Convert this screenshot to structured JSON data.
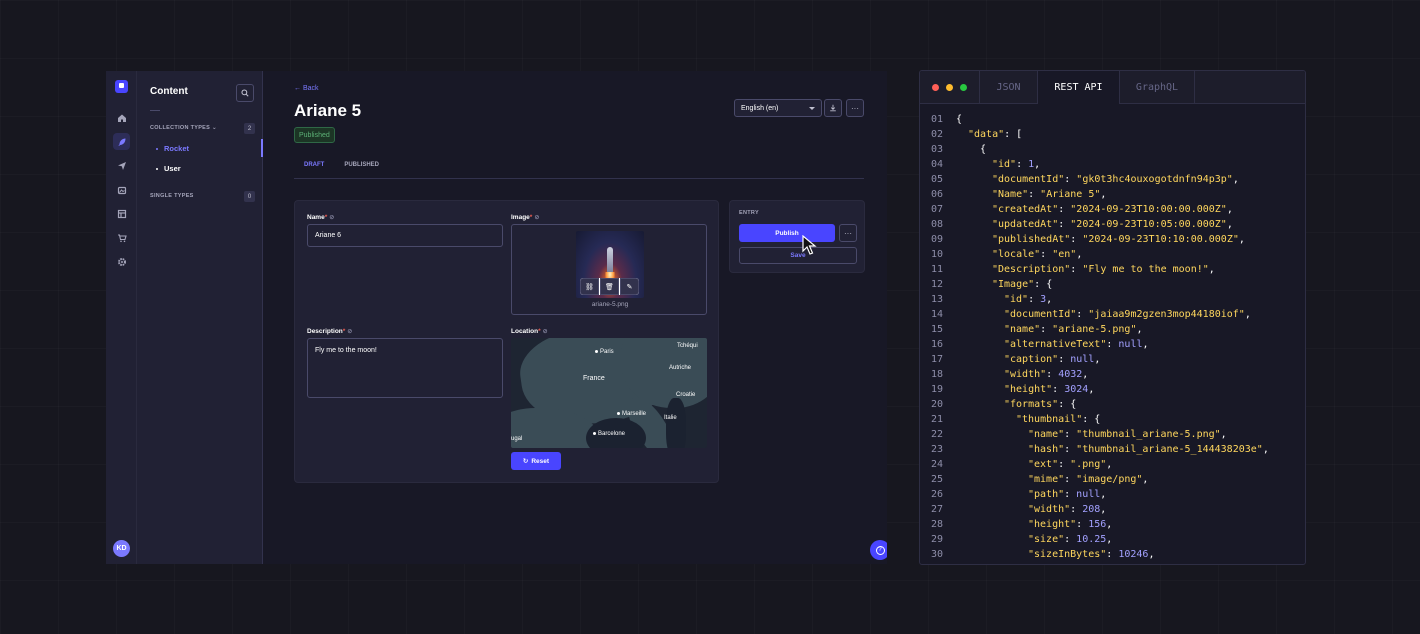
{
  "cms": {
    "nav": {
      "title": "Content",
      "collection_types_label": "COLLECTION TYPES",
      "collection_types_count": "2",
      "single_types_label": "SINGLE TYPES",
      "single_types_count": "0",
      "items": [
        {
          "label": "Rocket",
          "active": true
        },
        {
          "label": "User",
          "active": false
        }
      ],
      "user_initials": "KD"
    },
    "rail_icons": [
      "home-icon",
      "feather-icon",
      "paper-plane-icon",
      "media-library-icon",
      "layout-icon",
      "cart-icon",
      "gear-icon"
    ],
    "header": {
      "back_label": "Back",
      "title": "Ariane 5",
      "status": "Published",
      "locale": "English (en)"
    },
    "tabs": [
      {
        "label": "DRAFT",
        "active": true
      },
      {
        "label": "PUBLISHED",
        "active": false
      }
    ],
    "form": {
      "name_label": "Name",
      "name_value": "Ariane 6",
      "image_label": "Image",
      "image_filename": "ariane-5.png",
      "description_label": "Description",
      "description_value": "Fly me to the moon!",
      "location_label": "Location",
      "map_labels": [
        "Paris",
        "Tchéqui",
        "France",
        "Autriche",
        "Croatie",
        "Marseille",
        "Italie",
        "Barcelone",
        "ugal"
      ],
      "reset_label": "Reset"
    },
    "entry_panel": {
      "label": "ENTRY",
      "publish_label": "Publish",
      "save_label": "Save"
    },
    "colors": {
      "accent": "#4945ff",
      "accent_text": "#7b79ff",
      "success": "#5cb176"
    }
  },
  "code": {
    "tabs": [
      {
        "label": "JSON",
        "active": false
      },
      {
        "label": "REST API",
        "active": true
      },
      {
        "label": "GraphQL",
        "active": false
      }
    ],
    "lines": [
      {
        "n": "01",
        "indent": 0,
        "parts": [
          [
            "p",
            "{"
          ]
        ]
      },
      {
        "n": "02",
        "indent": 1,
        "parts": [
          [
            "s",
            "\"data\""
          ],
          [
            "p",
            ": ["
          ]
        ]
      },
      {
        "n": "03",
        "indent": 2,
        "parts": [
          [
            "p",
            "{"
          ]
        ]
      },
      {
        "n": "04",
        "indent": 3,
        "parts": [
          [
            "s",
            "\"id\""
          ],
          [
            "p",
            ": "
          ],
          [
            "n",
            "1"
          ],
          [
            "p",
            ","
          ]
        ]
      },
      {
        "n": "05",
        "indent": 3,
        "parts": [
          [
            "s",
            "\"documentId\""
          ],
          [
            "p",
            ": "
          ],
          [
            "s",
            "\"gk0t3hc4ouxogotdnfn94p3p\""
          ],
          [
            "p",
            ","
          ]
        ]
      },
      {
        "n": "06",
        "indent": 3,
        "parts": [
          [
            "s",
            "\"Name\""
          ],
          [
            "p",
            ": "
          ],
          [
            "s",
            "\"Ariane 5\""
          ],
          [
            "p",
            ","
          ]
        ]
      },
      {
        "n": "07",
        "indent": 3,
        "parts": [
          [
            "s",
            "\"createdAt\""
          ],
          [
            "p",
            ": "
          ],
          [
            "s",
            "\"2024-09-23T10:00:00.000Z\""
          ],
          [
            "p",
            ","
          ]
        ]
      },
      {
        "n": "08",
        "indent": 3,
        "parts": [
          [
            "s",
            "\"updatedAt\""
          ],
          [
            "p",
            ": "
          ],
          [
            "s",
            "\"2024-09-23T10:05:00.000Z\""
          ],
          [
            "p",
            ","
          ]
        ]
      },
      {
        "n": "09",
        "indent": 3,
        "parts": [
          [
            "s",
            "\"publishedAt\""
          ],
          [
            "p",
            ": "
          ],
          [
            "s",
            "\"2024-09-23T10:10:00.000Z\""
          ],
          [
            "p",
            ","
          ]
        ]
      },
      {
        "n": "10",
        "indent": 3,
        "parts": [
          [
            "s",
            "\"locale\""
          ],
          [
            "p",
            ": "
          ],
          [
            "s",
            "\"en\""
          ],
          [
            "p",
            ","
          ]
        ]
      },
      {
        "n": "11",
        "indent": 3,
        "parts": [
          [
            "s",
            "\"Description\""
          ],
          [
            "p",
            ": "
          ],
          [
            "s",
            "\"Fly me to the moon!\""
          ],
          [
            "p",
            ","
          ]
        ]
      },
      {
        "n": "12",
        "indent": 3,
        "parts": [
          [
            "s",
            "\"Image\""
          ],
          [
            "p",
            ": {"
          ]
        ]
      },
      {
        "n": "13",
        "indent": 4,
        "parts": [
          [
            "s",
            "\"id\""
          ],
          [
            "p",
            ": "
          ],
          [
            "n",
            "3"
          ],
          [
            "p",
            ","
          ]
        ]
      },
      {
        "n": "14",
        "indent": 4,
        "parts": [
          [
            "s",
            "\"documentId\""
          ],
          [
            "p",
            ": "
          ],
          [
            "s",
            "\"jaiaa9m2gzen3mop44180iof\""
          ],
          [
            "p",
            ","
          ]
        ]
      },
      {
        "n": "15",
        "indent": 4,
        "parts": [
          [
            "s",
            "\"name\""
          ],
          [
            "p",
            ": "
          ],
          [
            "s",
            "\"ariane-5.png\""
          ],
          [
            "p",
            ","
          ]
        ]
      },
      {
        "n": "16",
        "indent": 4,
        "parts": [
          [
            "s",
            "\"alternativeText\""
          ],
          [
            "p",
            ": "
          ],
          [
            "n",
            "null"
          ],
          [
            "p",
            ","
          ]
        ]
      },
      {
        "n": "17",
        "indent": 4,
        "parts": [
          [
            "s",
            "\"caption\""
          ],
          [
            "p",
            ": "
          ],
          [
            "n",
            "null"
          ],
          [
            "p",
            ","
          ]
        ]
      },
      {
        "n": "18",
        "indent": 4,
        "parts": [
          [
            "s",
            "\"width\""
          ],
          [
            "p",
            ": "
          ],
          [
            "n",
            "4032"
          ],
          [
            "p",
            ","
          ]
        ]
      },
      {
        "n": "19",
        "indent": 4,
        "parts": [
          [
            "s",
            "\"height\""
          ],
          [
            "p",
            ": "
          ],
          [
            "n",
            "3024"
          ],
          [
            "p",
            ","
          ]
        ]
      },
      {
        "n": "20",
        "indent": 4,
        "parts": [
          [
            "s",
            "\"formats\""
          ],
          [
            "p",
            ": {"
          ]
        ]
      },
      {
        "n": "21",
        "indent": 5,
        "parts": [
          [
            "s",
            "\"thumbnail\""
          ],
          [
            "p",
            ": {"
          ]
        ]
      },
      {
        "n": "22",
        "indent": 6,
        "parts": [
          [
            "s",
            "\"name\""
          ],
          [
            "p",
            ": "
          ],
          [
            "s",
            "\"thumbnail_ariane-5.png\""
          ],
          [
            "p",
            ","
          ]
        ]
      },
      {
        "n": "23",
        "indent": 6,
        "parts": [
          [
            "s",
            "\"hash\""
          ],
          [
            "p",
            ": "
          ],
          [
            "s",
            "\"thumbnail_ariane-5_144438203e\""
          ],
          [
            "p",
            ","
          ]
        ]
      },
      {
        "n": "24",
        "indent": 6,
        "parts": [
          [
            "s",
            "\"ext\""
          ],
          [
            "p",
            ": "
          ],
          [
            "s",
            "\".png\""
          ],
          [
            "p",
            ","
          ]
        ]
      },
      {
        "n": "25",
        "indent": 6,
        "parts": [
          [
            "s",
            "\"mime\""
          ],
          [
            "p",
            ": "
          ],
          [
            "s",
            "\"image/png\""
          ],
          [
            "p",
            ","
          ]
        ]
      },
      {
        "n": "26",
        "indent": 6,
        "parts": [
          [
            "s",
            "\"path\""
          ],
          [
            "p",
            ": "
          ],
          [
            "n",
            "null"
          ],
          [
            "p",
            ","
          ]
        ]
      },
      {
        "n": "27",
        "indent": 6,
        "parts": [
          [
            "s",
            "\"width\""
          ],
          [
            "p",
            ": "
          ],
          [
            "n",
            "208"
          ],
          [
            "p",
            ","
          ]
        ]
      },
      {
        "n": "28",
        "indent": 6,
        "parts": [
          [
            "s",
            "\"height\""
          ],
          [
            "p",
            ": "
          ],
          [
            "n",
            "156"
          ],
          [
            "p",
            ","
          ]
        ]
      },
      {
        "n": "29",
        "indent": 6,
        "parts": [
          [
            "s",
            "\"size\""
          ],
          [
            "p",
            ": "
          ],
          [
            "n",
            "10.25"
          ],
          [
            "p",
            ","
          ]
        ]
      },
      {
        "n": "30",
        "indent": 6,
        "parts": [
          [
            "s",
            "\"sizeInBytes\""
          ],
          [
            "p",
            ": "
          ],
          [
            "n",
            "10246"
          ],
          [
            "p",
            ","
          ]
        ]
      }
    ]
  }
}
